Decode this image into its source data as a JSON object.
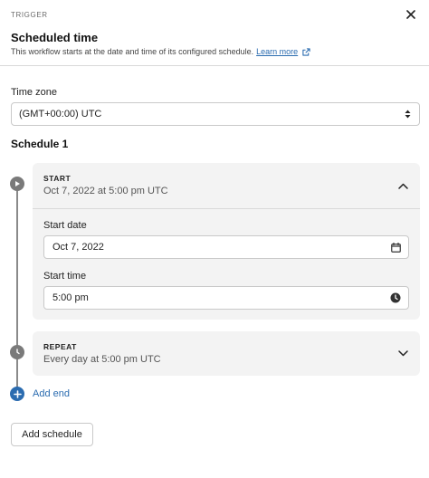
{
  "header": {
    "eyebrow": "TRIGGER",
    "title": "Scheduled time",
    "subtitle": "This workflow starts at the date and time of its configured schedule.",
    "learn_more": "Learn more"
  },
  "timezone": {
    "label": "Time zone",
    "value": "(GMT+00:00) UTC"
  },
  "schedule": {
    "title": "Schedule 1",
    "start": {
      "kicker": "START",
      "summary": "Oct 7, 2022 at 5:00 pm UTC",
      "date_label": "Start date",
      "date_value": "Oct 7, 2022",
      "time_label": "Start time",
      "time_value": "5:00 pm"
    },
    "repeat": {
      "kicker": "REPEAT",
      "summary": "Every day at 5:00 pm UTC"
    },
    "add_end": "Add end"
  },
  "footer": {
    "add_schedule": "Add schedule"
  },
  "colors": {
    "link": "#2b6cb0",
    "timeline": "#8a8a8a",
    "card_bg": "#f3f3f3"
  },
  "icons": [
    "close-icon",
    "external-link-icon",
    "sort-arrows-icon",
    "play-icon",
    "clock-icon",
    "chevron-up-icon",
    "chevron-down-icon",
    "calendar-icon",
    "plus-circle-icon"
  ]
}
